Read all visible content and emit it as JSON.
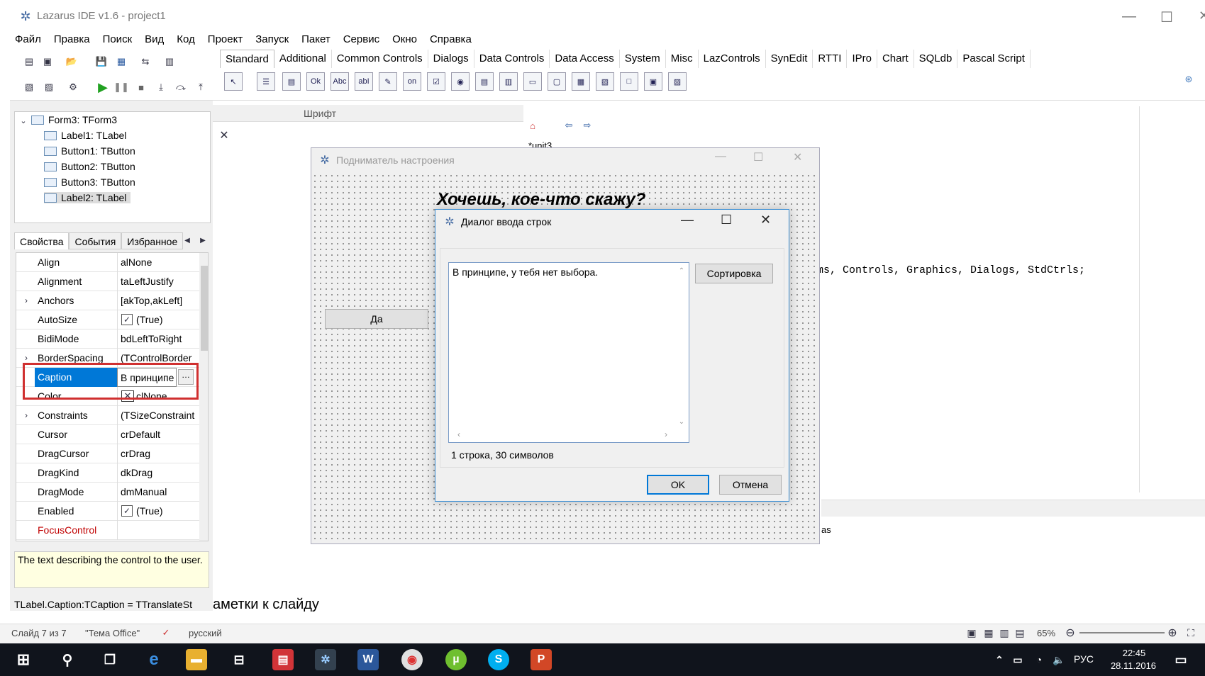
{
  "window": {
    "title": "Lazarus IDE v1.6 - project1"
  },
  "menu": [
    "Файл",
    "Правка",
    "Поиск",
    "Вид",
    "Код",
    "Проект",
    "Запуск",
    "Пакет",
    "Сервис",
    "Окно",
    "Справка"
  ],
  "palette_tabs": [
    "Standard",
    "Additional",
    "Common Controls",
    "Dialogs",
    "Data Controls",
    "Data Access",
    "System",
    "Misc",
    "LazControls",
    "SynEdit",
    "RTTI",
    "IPro",
    "Chart",
    "SQLdb",
    "Pascal Script"
  ],
  "palette_icons": [
    "Ok",
    "Abc",
    "abI",
    "on"
  ],
  "tree": {
    "root": "Form3: TForm3",
    "items": [
      "Label1: TLabel",
      "Button1: TButton",
      "Button2: TButton",
      "Button3: TButton",
      "Label2: TLabel"
    ]
  },
  "oi_tabs": [
    "Свойства",
    "События",
    "Избранное"
  ],
  "properties": [
    {
      "name": "Align",
      "value": "alNone"
    },
    {
      "name": "Alignment",
      "value": "taLeftJustify"
    },
    {
      "name": "Anchors",
      "value": "[akTop,akLeft]"
    },
    {
      "name": "AutoSize",
      "value": "(True)"
    },
    {
      "name": "BidiMode",
      "value": "bdLeftToRight"
    },
    {
      "name": "BorderSpacing",
      "value": "(TControlBorder"
    },
    {
      "name": "Caption",
      "value": "В принципе"
    },
    {
      "name": "Color",
      "value": "clNone"
    },
    {
      "name": "Constraints",
      "value": "(TSizeConstraint"
    },
    {
      "name": "Cursor",
      "value": "crDefault"
    },
    {
      "name": "DragCursor",
      "value": "crDrag"
    },
    {
      "name": "DragKind",
      "value": "dkDrag"
    },
    {
      "name": "DragMode",
      "value": "dmManual"
    },
    {
      "name": "Enabled",
      "value": "(True)"
    },
    {
      "name": "FocusControl",
      "value": ""
    }
  ],
  "hint": "The text describing the control to the user.",
  "oi_status": "TLabel.Caption:TCaption = TTranslateSt",
  "font_header": "Шрифт",
  "form3": {
    "title": "Подниматель настроения",
    "label1": "Хочешь, кое-что  скажу?",
    "button_da": "Да"
  },
  "dialog": {
    "title": "Диалог ввода строк",
    "memo_text": "В принципе, у тебя нет выбора.",
    "sort_button": "Сортировка",
    "status": "1 строка, 30 символов",
    "ok": "OK",
    "cancel": "Отмена"
  },
  "editor": {
    "tab": "*unit3",
    "code": "ms, Controls, Graphics, Dialogs, StdCtrls;",
    "bottom_tab": "as"
  },
  "ppt": {
    "notes": "аметки к слайду",
    "slide": "Слайд 7 из 7",
    "theme": "\"Тема Office\"",
    "lang": "русский",
    "zoom": "65%"
  },
  "taskbar": {
    "lang": "РУС",
    "time": "22:45",
    "date": "28.11.2016"
  }
}
